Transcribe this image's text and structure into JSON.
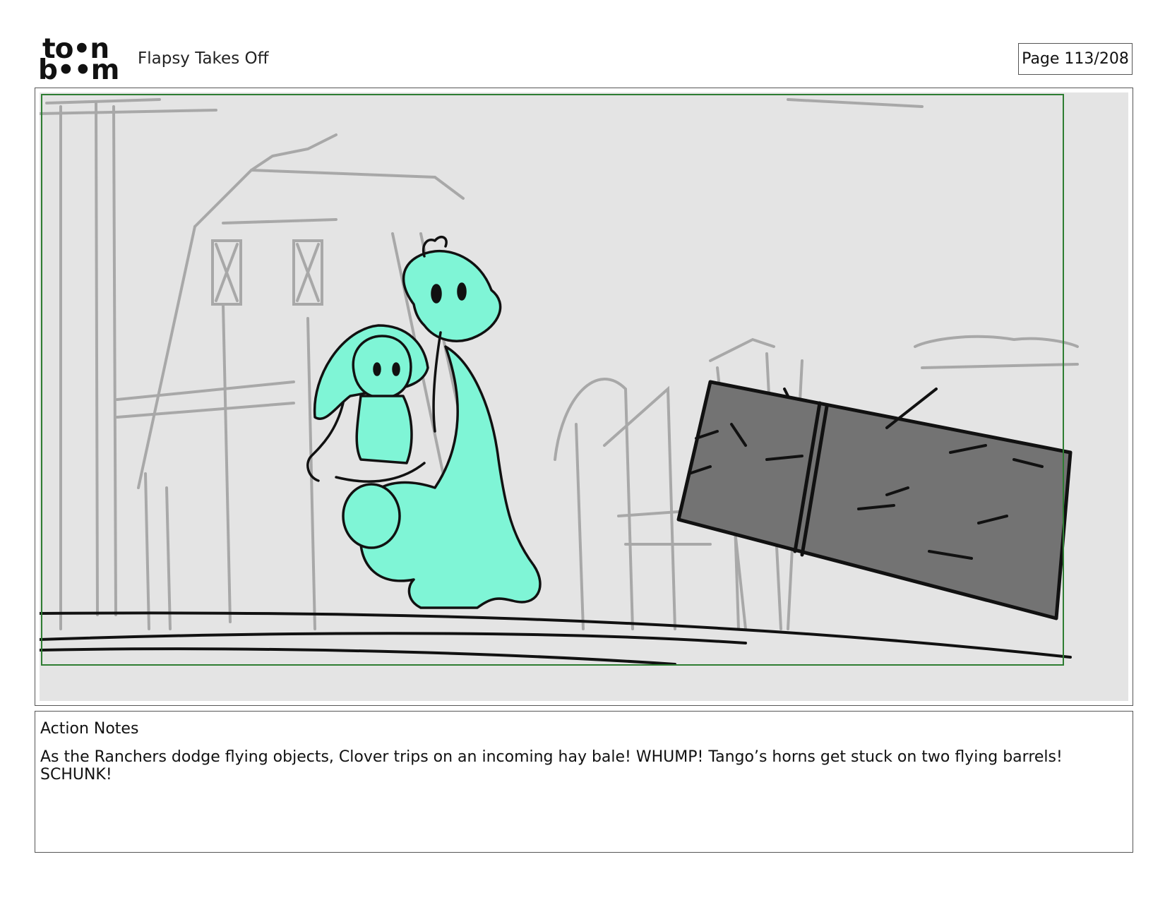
{
  "header": {
    "logo_text_top": "to•n",
    "logo_text_bottom": "b••m",
    "title": "Flapsy Takes Off",
    "page_indicator": "Page 113/208"
  },
  "panel": {
    "safe_frame_color": "#2e7d32",
    "background_color": "#e4e4e4",
    "character_color": "#7ff5d6",
    "hay_bale_color": "#737373",
    "sketch_color": "#a8a8a8"
  },
  "notes": {
    "label": "Action Notes",
    "text": "As the Ranchers dodge flying objects, Clover trips on an incoming hay bale! WHUMP! Tango’s horns get stuck on two flying barrels! SCHUNK!"
  }
}
